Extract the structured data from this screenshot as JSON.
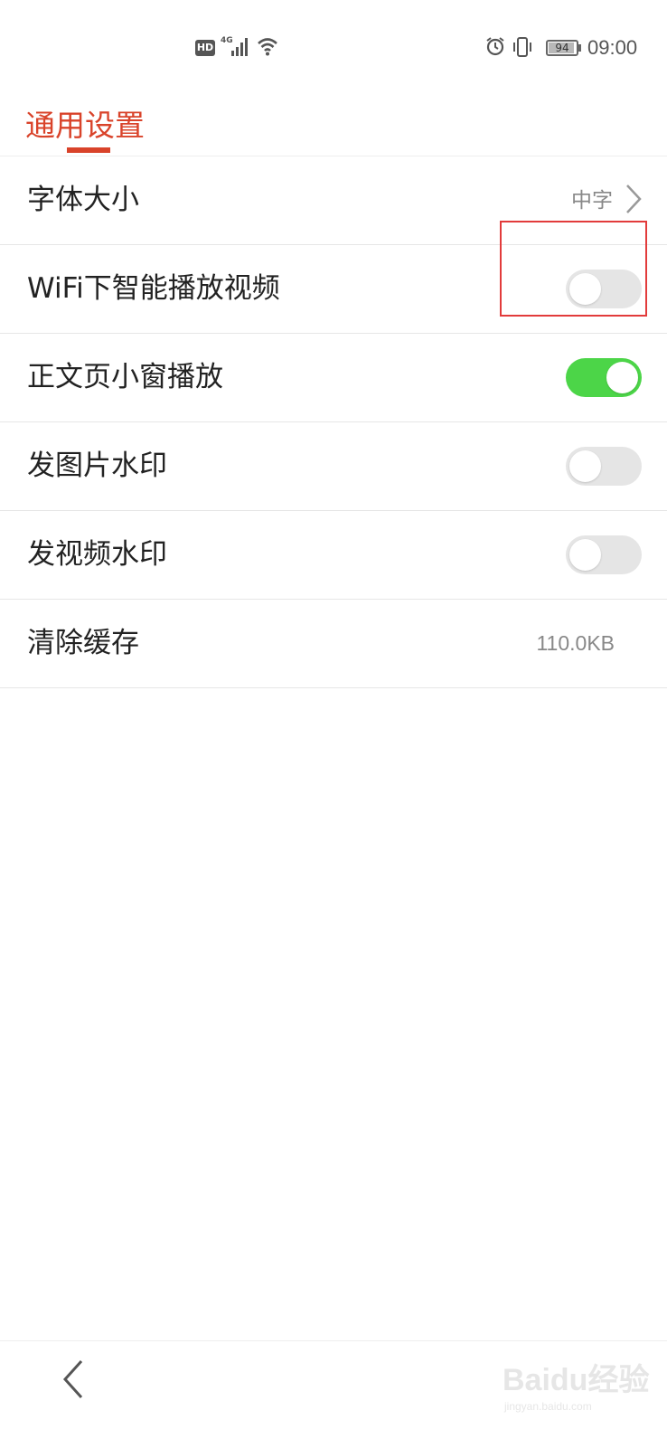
{
  "status_bar": {
    "hd_label": "HD",
    "network_label": "4G",
    "battery_level": 94,
    "battery_text": "94",
    "time": "09:00",
    "icons": [
      "hd-icon",
      "signal-icon",
      "wifi-icon",
      "alarm-icon",
      "vibrate-icon",
      "battery-icon"
    ]
  },
  "header": {
    "tab_label": "通用设置",
    "accent_color": "#d9432a"
  },
  "settings": {
    "items": [
      {
        "label": "字体大小",
        "value": "中字",
        "type": "nav"
      },
      {
        "label": "WiFi下智能播放视频",
        "type": "toggle",
        "on": false
      },
      {
        "label": "正文页小窗播放",
        "type": "toggle",
        "on": true
      },
      {
        "label": "发图片水印",
        "type": "toggle",
        "on": false
      },
      {
        "label": "发视频水印",
        "type": "toggle",
        "on": false
      },
      {
        "label": "清除缓存",
        "value": "110.0KB",
        "type": "value"
      }
    ]
  },
  "annotation": {
    "color": "#e23b3b"
  },
  "nav": {
    "back_icon": "chevron-left-icon"
  },
  "watermark": {
    "text": "Baidu经验",
    "sub": "jingyan.baidu.com"
  }
}
